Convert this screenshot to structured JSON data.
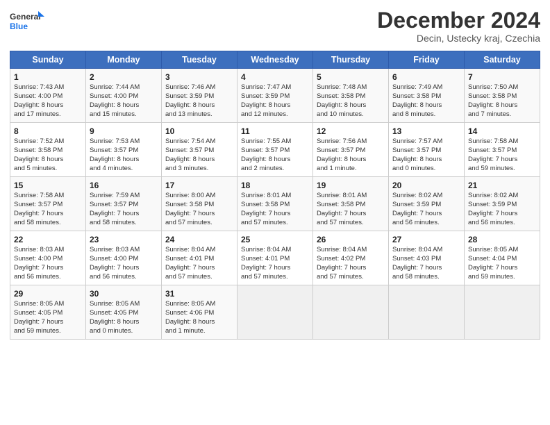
{
  "header": {
    "logo_line1": "General",
    "logo_line2": "Blue",
    "month": "December 2024",
    "location": "Decin, Ustecky kraj, Czechia"
  },
  "days_of_week": [
    "Sunday",
    "Monday",
    "Tuesday",
    "Wednesday",
    "Thursday",
    "Friday",
    "Saturday"
  ],
  "weeks": [
    [
      {
        "day": 1,
        "info": "Sunrise: 7:43 AM\nSunset: 4:00 PM\nDaylight: 8 hours\nand 17 minutes."
      },
      {
        "day": 2,
        "info": "Sunrise: 7:44 AM\nSunset: 4:00 PM\nDaylight: 8 hours\nand 15 minutes."
      },
      {
        "day": 3,
        "info": "Sunrise: 7:46 AM\nSunset: 3:59 PM\nDaylight: 8 hours\nand 13 minutes."
      },
      {
        "day": 4,
        "info": "Sunrise: 7:47 AM\nSunset: 3:59 PM\nDaylight: 8 hours\nand 12 minutes."
      },
      {
        "day": 5,
        "info": "Sunrise: 7:48 AM\nSunset: 3:58 PM\nDaylight: 8 hours\nand 10 minutes."
      },
      {
        "day": 6,
        "info": "Sunrise: 7:49 AM\nSunset: 3:58 PM\nDaylight: 8 hours\nand 8 minutes."
      },
      {
        "day": 7,
        "info": "Sunrise: 7:50 AM\nSunset: 3:58 PM\nDaylight: 8 hours\nand 7 minutes."
      }
    ],
    [
      {
        "day": 8,
        "info": "Sunrise: 7:52 AM\nSunset: 3:58 PM\nDaylight: 8 hours\nand 5 minutes."
      },
      {
        "day": 9,
        "info": "Sunrise: 7:53 AM\nSunset: 3:57 PM\nDaylight: 8 hours\nand 4 minutes."
      },
      {
        "day": 10,
        "info": "Sunrise: 7:54 AM\nSunset: 3:57 PM\nDaylight: 8 hours\nand 3 minutes."
      },
      {
        "day": 11,
        "info": "Sunrise: 7:55 AM\nSunset: 3:57 PM\nDaylight: 8 hours\nand 2 minutes."
      },
      {
        "day": 12,
        "info": "Sunrise: 7:56 AM\nSunset: 3:57 PM\nDaylight: 8 hours\nand 1 minute."
      },
      {
        "day": 13,
        "info": "Sunrise: 7:57 AM\nSunset: 3:57 PM\nDaylight: 8 hours\nand 0 minutes."
      },
      {
        "day": 14,
        "info": "Sunrise: 7:58 AM\nSunset: 3:57 PM\nDaylight: 7 hours\nand 59 minutes."
      }
    ],
    [
      {
        "day": 15,
        "info": "Sunrise: 7:58 AM\nSunset: 3:57 PM\nDaylight: 7 hours\nand 58 minutes."
      },
      {
        "day": 16,
        "info": "Sunrise: 7:59 AM\nSunset: 3:57 PM\nDaylight: 7 hours\nand 58 minutes."
      },
      {
        "day": 17,
        "info": "Sunrise: 8:00 AM\nSunset: 3:58 PM\nDaylight: 7 hours\nand 57 minutes."
      },
      {
        "day": 18,
        "info": "Sunrise: 8:01 AM\nSunset: 3:58 PM\nDaylight: 7 hours\nand 57 minutes."
      },
      {
        "day": 19,
        "info": "Sunrise: 8:01 AM\nSunset: 3:58 PM\nDaylight: 7 hours\nand 57 minutes."
      },
      {
        "day": 20,
        "info": "Sunrise: 8:02 AM\nSunset: 3:59 PM\nDaylight: 7 hours\nand 56 minutes."
      },
      {
        "day": 21,
        "info": "Sunrise: 8:02 AM\nSunset: 3:59 PM\nDaylight: 7 hours\nand 56 minutes."
      }
    ],
    [
      {
        "day": 22,
        "info": "Sunrise: 8:03 AM\nSunset: 4:00 PM\nDaylight: 7 hours\nand 56 minutes."
      },
      {
        "day": 23,
        "info": "Sunrise: 8:03 AM\nSunset: 4:00 PM\nDaylight: 7 hours\nand 56 minutes."
      },
      {
        "day": 24,
        "info": "Sunrise: 8:04 AM\nSunset: 4:01 PM\nDaylight: 7 hours\nand 57 minutes."
      },
      {
        "day": 25,
        "info": "Sunrise: 8:04 AM\nSunset: 4:01 PM\nDaylight: 7 hours\nand 57 minutes."
      },
      {
        "day": 26,
        "info": "Sunrise: 8:04 AM\nSunset: 4:02 PM\nDaylight: 7 hours\nand 57 minutes."
      },
      {
        "day": 27,
        "info": "Sunrise: 8:04 AM\nSunset: 4:03 PM\nDaylight: 7 hours\nand 58 minutes."
      },
      {
        "day": 28,
        "info": "Sunrise: 8:05 AM\nSunset: 4:04 PM\nDaylight: 7 hours\nand 59 minutes."
      }
    ],
    [
      {
        "day": 29,
        "info": "Sunrise: 8:05 AM\nSunset: 4:05 PM\nDaylight: 7 hours\nand 59 minutes."
      },
      {
        "day": 30,
        "info": "Sunrise: 8:05 AM\nSunset: 4:05 PM\nDaylight: 8 hours\nand 0 minutes."
      },
      {
        "day": 31,
        "info": "Sunrise: 8:05 AM\nSunset: 4:06 PM\nDaylight: 8 hours\nand 1 minute."
      },
      null,
      null,
      null,
      null
    ]
  ]
}
